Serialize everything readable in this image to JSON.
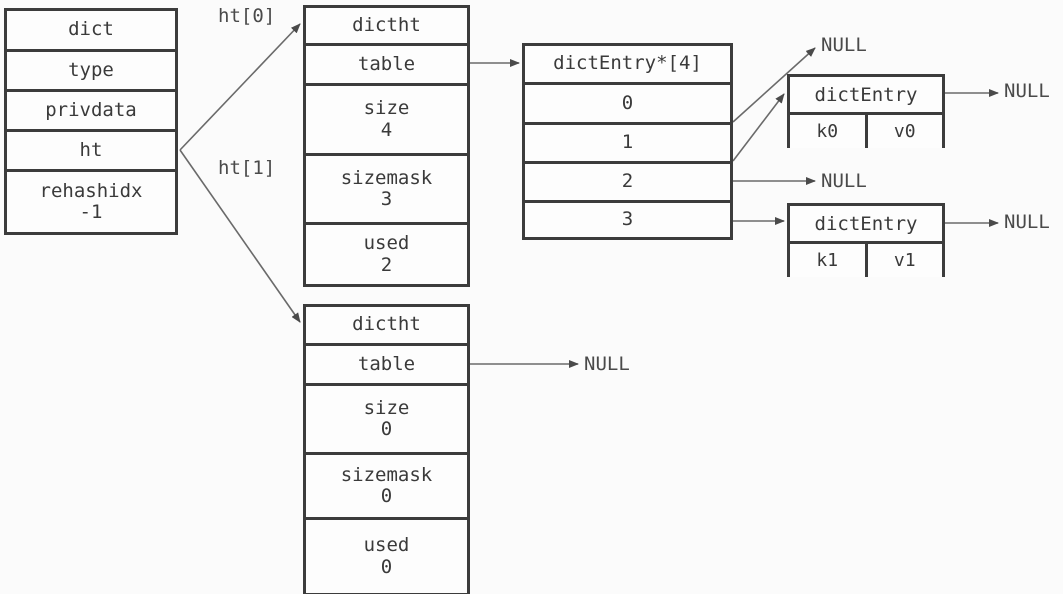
{
  "diagram": {
    "title": "redis dict / dictht / dictEntry structure",
    "stroke_color": "#3c3c3c",
    "arrow_color": "#6a6a6a",
    "background": "#fbfbfb"
  },
  "dict": {
    "title": "dict",
    "fields": [
      {
        "name": "type",
        "value": ""
      },
      {
        "name": "privdata",
        "value": ""
      },
      {
        "name": "ht",
        "value": ""
      },
      {
        "name": "rehashidx",
        "value": "-1"
      }
    ]
  },
  "pointer_labels": {
    "ht0": "ht[0]",
    "ht1": "ht[1]"
  },
  "dictht0": {
    "title": "dictht",
    "fields": [
      {
        "name": "table",
        "value": ""
      },
      {
        "name": "size",
        "value": "4"
      },
      {
        "name": "sizemask",
        "value": "3"
      },
      {
        "name": "used",
        "value": "2"
      }
    ]
  },
  "dictht1": {
    "title": "dictht",
    "fields": [
      {
        "name": "table",
        "value": ""
      },
      {
        "name": "size",
        "value": "0"
      },
      {
        "name": "sizemask",
        "value": "0"
      },
      {
        "name": "used",
        "value": "0"
      }
    ]
  },
  "entry_table": {
    "title": "dictEntry*[4]",
    "indices": [
      "0",
      "1",
      "2",
      "3"
    ]
  },
  "entries": [
    {
      "title": "dictEntry",
      "key": "k0",
      "value": "v0"
    },
    {
      "title": "dictEntry",
      "key": "k1",
      "value": "v1"
    }
  ],
  "nulls": {
    "bucket0": "NULL",
    "entry0_next": "NULL",
    "bucket2": "NULL",
    "entry1_next": "NULL",
    "dictht1_table": "NULL"
  }
}
